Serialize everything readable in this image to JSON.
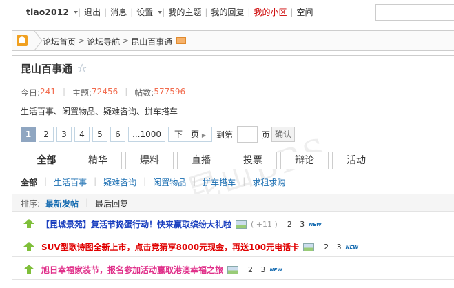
{
  "topbar": {
    "username": "tiao2012",
    "items": [
      "退出",
      "消息",
      "设置",
      "我的主题",
      "我的回复",
      "我的小区",
      "空间"
    ]
  },
  "breadcrumb": [
    "论坛首页",
    "论坛导航",
    "昆山百事通"
  ],
  "forum": {
    "title": "昆山百事通",
    "stats": {
      "today_label": "今日:",
      "today": "241",
      "topics_label": "主题:",
      "topics": "72456",
      "posts_label": "帖数:",
      "posts": "577596"
    },
    "description": "生活百事、闲置物品、疑难咨询、拼车搭车"
  },
  "pager": {
    "pages": [
      "1",
      "2",
      "3",
      "4",
      "5",
      "6",
      "...1000"
    ],
    "next": "下一页",
    "jump_label": "到第",
    "page_unit": "页",
    "confirm": "确认"
  },
  "watermark": "昆山BBS",
  "tabs": [
    "全部",
    "精华",
    "爆料",
    "直播",
    "投票",
    "辩论",
    "活动"
  ],
  "subcategories": [
    "全部",
    "生活百事",
    "疑难咨询",
    "闲置物品",
    "拼车搭车",
    "求租求购"
  ],
  "sort": {
    "label": "排序:",
    "options": [
      "最新发帖",
      "最后回复"
    ]
  },
  "threads": [
    {
      "title": "【昆城景苑】复活节捣蛋行动！快来赢取缤纷大礼啦",
      "color": "#1a3fbf",
      "more": "( +11 )",
      "pages": "2 3",
      "new": "NEW"
    },
    {
      "title": "SUV型歌诗图全新上市，点击竞猜享8000元现金，再送100元电话卡",
      "color": "#e00000",
      "more": "",
      "pages": "2 3",
      "new": "NEW"
    },
    {
      "title": "旭日幸福家装节，报名参加活动赢取港澳幸福之旅",
      "color": "#e0308a",
      "more": "",
      "pages": "2 3",
      "new": "NEW"
    }
  ]
}
